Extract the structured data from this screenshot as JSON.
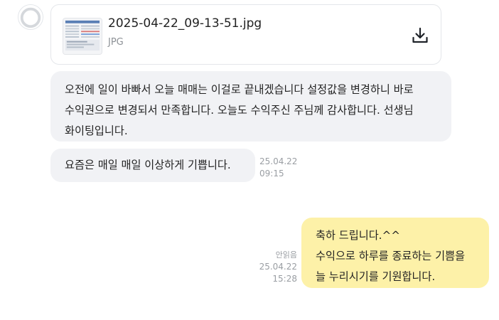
{
  "attachment": {
    "file_name": "2025-04-22_09-13-51.jpg",
    "file_type": "JPG"
  },
  "icons": {
    "avatar": "default-avatar-icon",
    "thumbnail": "image-thumbnail-icon",
    "download": "download-icon"
  },
  "colors": {
    "incoming_bubble": "#f1f2f5",
    "outgoing_bubble": "#fdf1a8",
    "meta_text": "#9a9ea3"
  },
  "messages": [
    {
      "direction": "incoming",
      "lines": [
        "오전에 일이 바빠서 오늘 매매는 이걸로 끝내겠습니다 설정값을 변경하니 바로",
        "수익권으로 변경되서 만족합니다. 오늘도 수익주신 주님께 감사합니다. 선생님",
        "화이팅입니다."
      ]
    },
    {
      "direction": "incoming",
      "lines": [
        "요즘은 매일 매일 이상하게 기쁩니다."
      ],
      "date": "25.04.22",
      "time": "09:15"
    },
    {
      "direction": "outgoing",
      "lines": [
        "축하 드립니다.^^",
        "수익으로 하루를 종료하는 기쁨을",
        "늘 누리시기를 기원합니다."
      ],
      "read_status": "안읽음",
      "date": "25.04.22",
      "time": "15:28"
    }
  ]
}
